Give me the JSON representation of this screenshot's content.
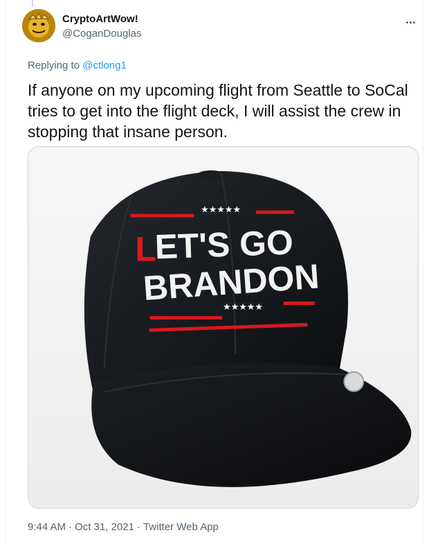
{
  "tweet": {
    "display_name": "CryptoArtWow!",
    "handle": "@CoganDouglas",
    "replying_prefix": "Replying to",
    "replying_to": "@ctlong1",
    "text": "If anyone on my upcoming flight from Seattle to SoCal tries to get into the flight deck, I will assist the crew in stopping that insane person.",
    "time": "9:44 AM",
    "date": "Oct 31, 2021",
    "source": "Twitter Web App",
    "separator": "·"
  },
  "media": {
    "hat_line1_red": "L",
    "hat_line1_white": "ET'S GO",
    "hat_line2": "BRANDON",
    "stars": "★★★★★"
  },
  "colors": {
    "link": "#1d9bf0",
    "secondary": "#536471",
    "hat_red": "#d71920",
    "hat_body": "#15181c"
  }
}
